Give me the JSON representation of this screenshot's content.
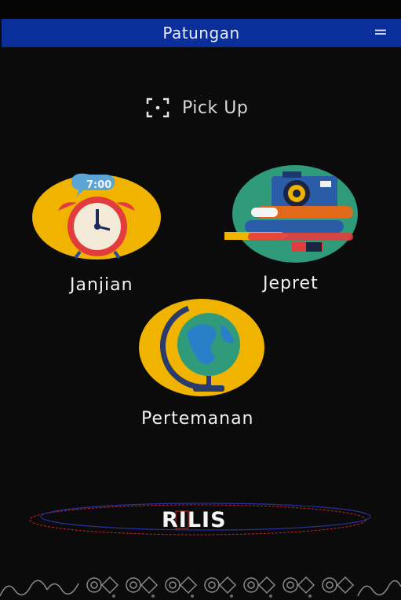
{
  "app": {
    "title": "Patungan"
  },
  "menu_icon": "hamburger-menu-icon",
  "pickup": {
    "label": "Pick Up",
    "icon": "scan-icon"
  },
  "menu": {
    "janjian": {
      "label": "Janjian",
      "icon": "alarm-clock-icon",
      "clock_time": "7:00"
    },
    "jepret": {
      "label": "Jepret",
      "icon": "camera-icon"
    },
    "pertemanan": {
      "label": "Pertemanan",
      "icon": "globe-icon"
    }
  },
  "rilis": {
    "label": "RILIS"
  },
  "colors": {
    "appbar": "#0a2f9a",
    "background": "#0b0b0b",
    "icon_yellow": "#f0b400",
    "icon_teal": "#2f9b7a"
  }
}
